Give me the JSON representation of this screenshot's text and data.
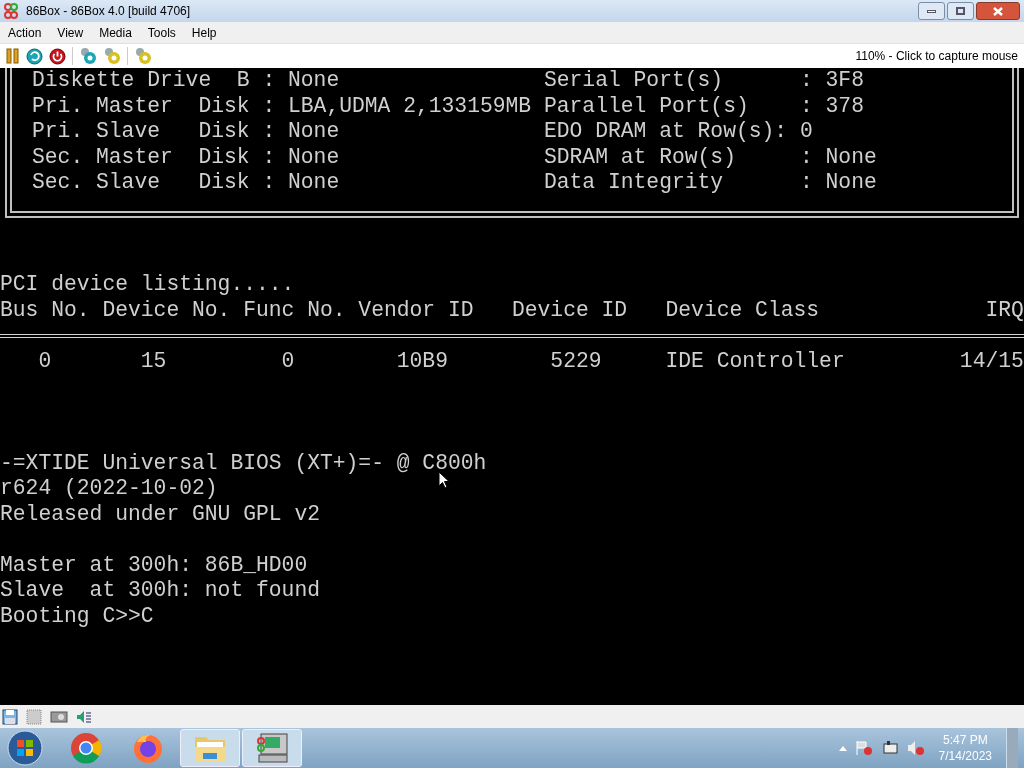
{
  "window": {
    "title": "86Box - 86Box 4.0 [build 4706]"
  },
  "menu": [
    "Action",
    "View",
    "Media",
    "Tools",
    "Help"
  ],
  "toolbar": {
    "status_text": "110% - Click to capture mouse"
  },
  "screen": {
    "bios_box": [
      {
        "left": "Diskette Drive  B : None",
        "right": "Serial Port(s)      : 3F8"
      },
      {
        "left": "Pri. Master  Disk : LBA,UDMA 2,133159MB",
        "right": "Parallel Port(s)    : 378"
      },
      {
        "left": "Pri. Slave   Disk : None",
        "right": "EDO DRAM at Row(s): 0"
      },
      {
        "left": "Sec. Master  Disk : None",
        "right": "SDRAM at Row(s)     : None"
      },
      {
        "left": "Sec. Slave   Disk : None",
        "right": "Data Integrity      : None"
      }
    ],
    "pci_title": "PCI device listing.....",
    "pci_columns": [
      "Bus No.",
      "Device No.",
      "Func No.",
      "Vendor ID",
      "Device ID",
      "Device Class",
      "IRQ"
    ],
    "pci_rows": [
      [
        "0",
        "15",
        "0",
        "10B9",
        "5229",
        "IDE Controller",
        "14/15"
      ]
    ],
    "boot_lines": [
      "-=XTIDE Universal BIOS (XT+)=- @ C800h",
      "r624 (2022-10-02)",
      "Released under GNU GPL v2"
    ],
    "drive_lines": [
      "Master at 300h: 86B_HD00",
      "Slave  at 300h: not found",
      "Booting C>>C"
    ]
  },
  "taskbar": {
    "items": [
      {
        "kind": "chrome",
        "running": false
      },
      {
        "kind": "firefox",
        "running": false
      },
      {
        "kind": "folder",
        "running": true
      },
      {
        "kind": "emulator",
        "running": true
      }
    ],
    "time": "5:47 PM",
    "date": "7/14/2023"
  }
}
